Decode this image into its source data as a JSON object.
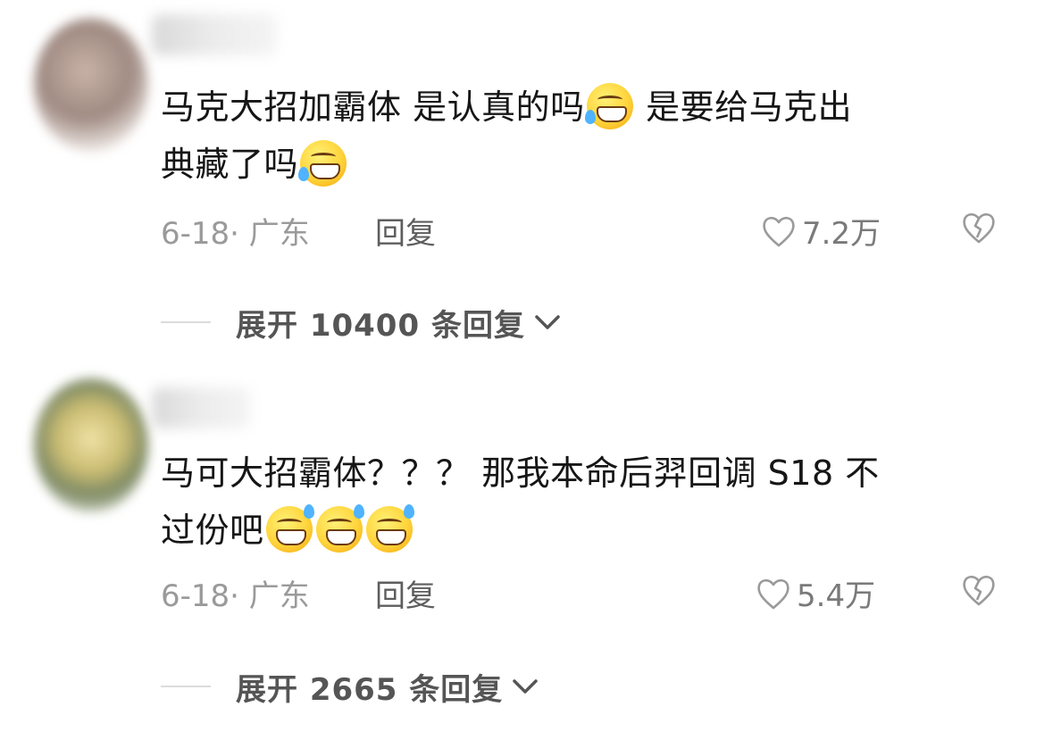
{
  "comments": [
    {
      "text_lines": [
        "马克大招加霸体 是认真的吗",
        " 是要给马克出",
        "典藏了吗"
      ],
      "date": "6-18",
      "location": "广东",
      "reply_label": "回复",
      "likes": "7.2万",
      "expand_label": "展开 10400 条回复",
      "emoji": "rolling-on-floor-laughing"
    },
    {
      "text_lines": [
        "马可大招霸体？？？ 那我本命后羿回调 S18 不",
        "过份吧"
      ],
      "date": "6-18",
      "location": "广东",
      "reply_label": "回复",
      "likes": "5.4万",
      "expand_label": "展开 2665 条回复",
      "emoji": "grinning-face-with-sweat"
    }
  ],
  "colors": {
    "text": "#161616",
    "meta": "#9a9a9a",
    "reply": "#5e5e5e",
    "expand": "#555555"
  }
}
